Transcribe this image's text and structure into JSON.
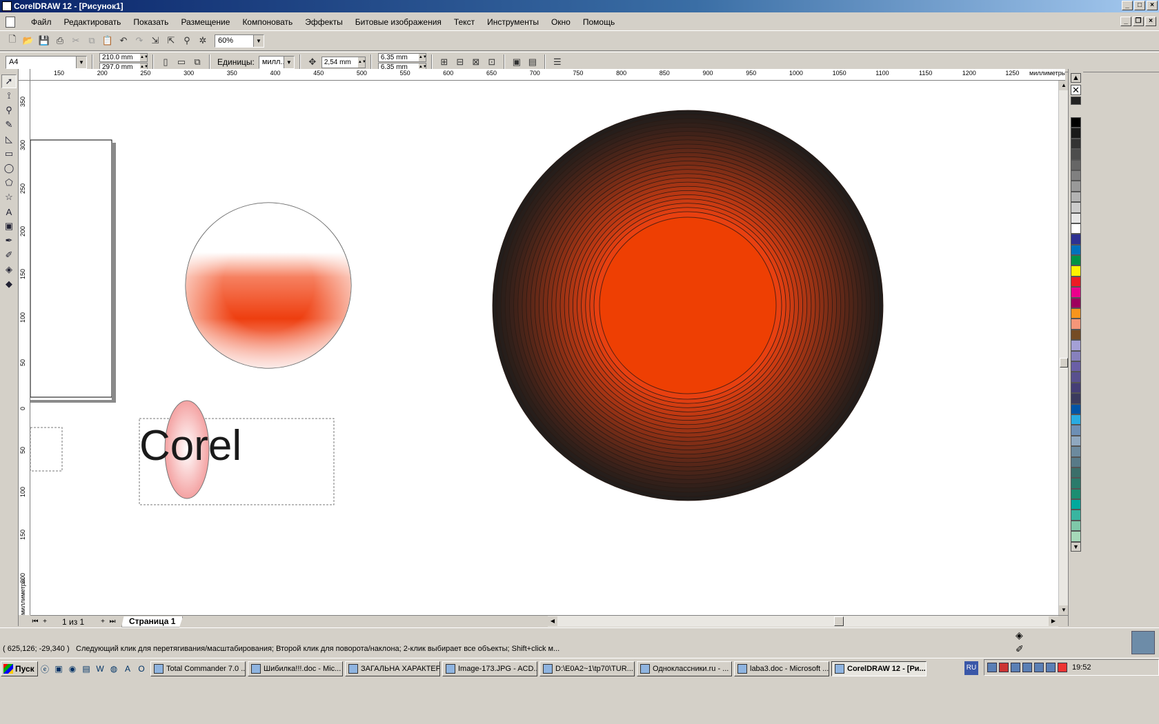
{
  "window": {
    "title": "CorelDRAW 12 - [Рисунок1]"
  },
  "menu": [
    "Файл",
    "Редактировать",
    "Показать",
    "Размещение",
    "Компоновать",
    "Эффекты",
    "Битовые изображения",
    "Текст",
    "Инструменты",
    "Окно",
    "Помощь"
  ],
  "toolbar": {
    "zoom": "60%"
  },
  "property_bar": {
    "page_size": "A4",
    "width": "210.0 mm",
    "height": "297.0 mm",
    "units_label": "Единицы:",
    "units_value": "милл...",
    "nudge": "2,54 mm",
    "dup_x": "6.35 mm",
    "dup_y": "6.35 mm"
  },
  "ruler": {
    "h_labels": [
      "150",
      "200",
      "250",
      "300",
      "350",
      "400",
      "450",
      "500",
      "550",
      "600",
      "650",
      "700",
      "750",
      "800",
      "850",
      "900",
      "950",
      "1000",
      "1050",
      "1100",
      "1150",
      "1200",
      "1250"
    ],
    "h_unit": "миллиметры",
    "v_labels": [
      "350",
      "300",
      "250",
      "200",
      "150",
      "100",
      "50",
      "0",
      "50",
      "100",
      "150",
      "200"
    ],
    "v_unit": "миллиметры"
  },
  "canvas": {
    "text_object": "Corel"
  },
  "navigator": {
    "page_count": "1 из 1",
    "page_tab": "Страница 1"
  },
  "status": {
    "coords": "( 625,126; -29,340 )",
    "message": "Следующий клик для перетягивания/масштабирования; Второй клик для поворота/наклона; 2-клик выбирает все объекты; Shift+click м..."
  },
  "palette": [
    "#000000",
    "#1a1a1a",
    "#333333",
    "#4d4d4d",
    "#666666",
    "#808080",
    "#999999",
    "#b3b3b3",
    "#cccccc",
    "#e6e6e6",
    "#ffffff",
    "#2e3192",
    "#0071bc",
    "#009245",
    "#fff200",
    "#ed1c24",
    "#ec008c",
    "#9e005d",
    "#f7941d",
    "#f69679",
    "#754c24",
    "#a4a0d6",
    "#8781bd",
    "#6a5fa6",
    "#58508e",
    "#453e76",
    "#3b3b5e",
    "#0054a6",
    "#29abe2",
    "#6d8fb5",
    "#8fa8c0",
    "#6c8a9e",
    "#587a88",
    "#3b6f6a",
    "#2a7b6b",
    "#1b8e72",
    "#00a99d",
    "#39b5a0",
    "#7fc8a9",
    "#a6d9b9"
  ],
  "taskbar": {
    "start": "Пуск",
    "tasks": [
      "Total Commander 7.0 ...",
      "Шибилка!!!.doc - Mic...",
      "ЗАГАЛЬНА ХАРАКТЕР...",
      "Image-173.JPG - ACD...",
      "D:\\E0A2~1\\tp70\\TUR...",
      "Одноклассники.ru - ...",
      "laba3.doc - Microsoft ...",
      "CorelDRAW 12 - [Ри..."
    ],
    "lang": "RU",
    "clock": "19:52"
  }
}
